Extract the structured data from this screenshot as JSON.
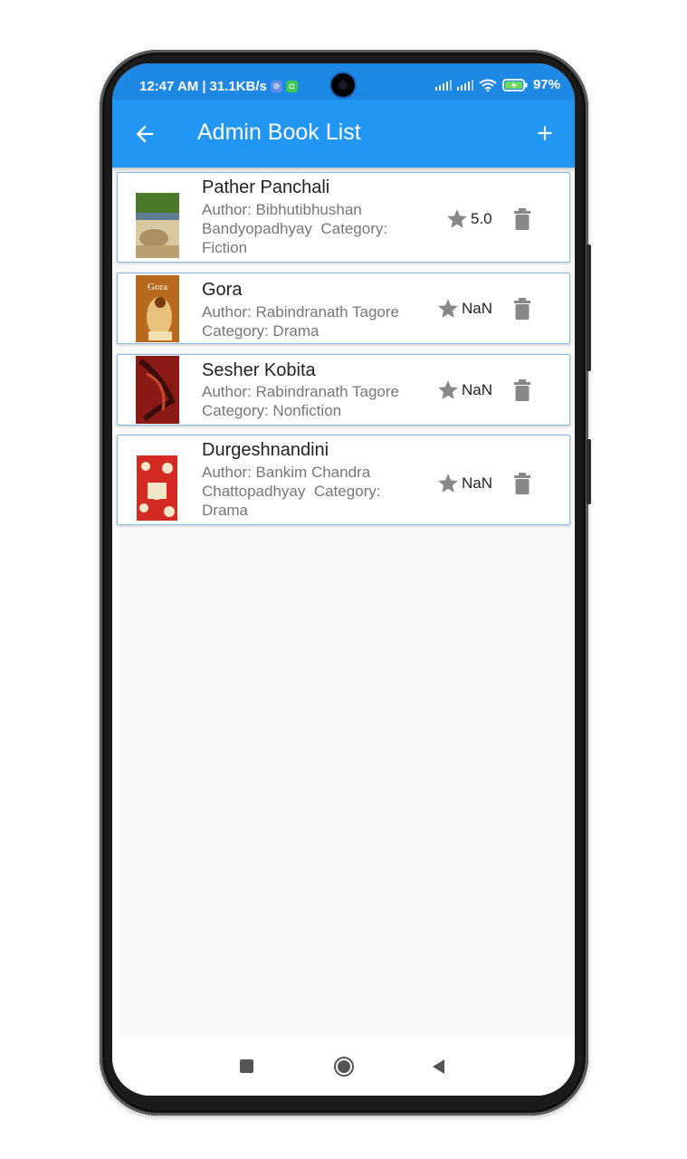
{
  "status_bar": {
    "time": "12:47 AM",
    "network_speed": "31.1KB/s",
    "battery": "97%"
  },
  "app_bar": {
    "title": "Admin Book List",
    "back_icon": "arrow-back-icon",
    "add_icon": "plus-icon"
  },
  "books": [
    {
      "title": "Pather Panchali",
      "author": "Author: Bibhutibhushan Bandyopadhyay",
      "category": "Category: Fiction",
      "rating": "5.0",
      "cover_colors": [
        "#d9c9a0",
        "#6b8f3a",
        "#8a6d3b"
      ]
    },
    {
      "title": "Gora",
      "author": "Author: Rabindranath Tagore",
      "category": "Category: Drama",
      "rating": "NaN",
      "cover_text": "Gora",
      "cover_colors": [
        "#b86a1e",
        "#e8c27a",
        "#7a3b10"
      ]
    },
    {
      "title": "Sesher Kobita",
      "author": "Author: Rabindranath Tagore",
      "category": "Category: Nonfiction",
      "rating": "NaN",
      "cover_colors": [
        "#8b1a16",
        "#3a0c0a",
        "#c84a2a"
      ]
    },
    {
      "title": "Durgeshnandini",
      "author": "Author: Bankim Chandra Chattopadhyay",
      "category": "Category: Drama",
      "rating": "NaN",
      "cover_colors": [
        "#d42a24",
        "#f2e6c8",
        "#a01812"
      ]
    }
  ],
  "accent_color": "#2196f3",
  "icons": {
    "rating": "star-icon",
    "delete": "trash-icon"
  }
}
